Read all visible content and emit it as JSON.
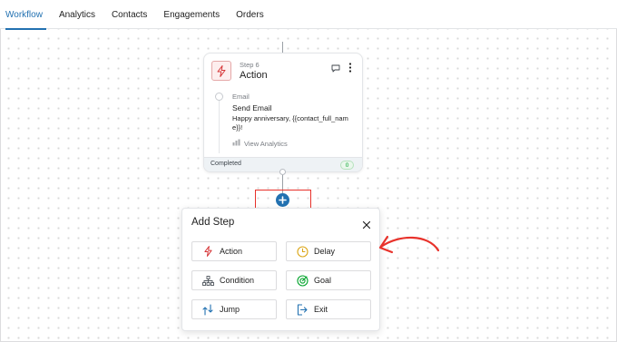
{
  "tabs": [
    {
      "label": "Workflow",
      "active": true
    },
    {
      "label": "Analytics",
      "active": false
    },
    {
      "label": "Contacts",
      "active": false
    },
    {
      "label": "Engagements",
      "active": false
    },
    {
      "label": "Orders",
      "active": false
    }
  ],
  "step_card": {
    "step_number": "Step 6",
    "title": "Action",
    "icon": "lightning-icon",
    "content_label": "Email",
    "content_title": "Send Email",
    "content_body": "Happy anniversary, {{contact_full_name}}!",
    "analytics_link": "View Analytics",
    "footer_status": "Completed",
    "footer_count": "0"
  },
  "add_step": {
    "title": "Add Step",
    "options": [
      {
        "label": "Action",
        "icon": "lightning-icon"
      },
      {
        "label": "Delay",
        "icon": "clock-icon"
      },
      {
        "label": "Condition",
        "icon": "hierarchy-icon"
      },
      {
        "label": "Goal",
        "icon": "target-icon"
      },
      {
        "label": "Jump",
        "icon": "jump-icon"
      },
      {
        "label": "Exit",
        "icon": "exit-icon"
      }
    ]
  },
  "colors": {
    "accent": "#2271b1",
    "highlight": "#e8322b",
    "action_red": "#d63638",
    "delay_orange": "#dba617",
    "goal_green": "#00a32a"
  }
}
